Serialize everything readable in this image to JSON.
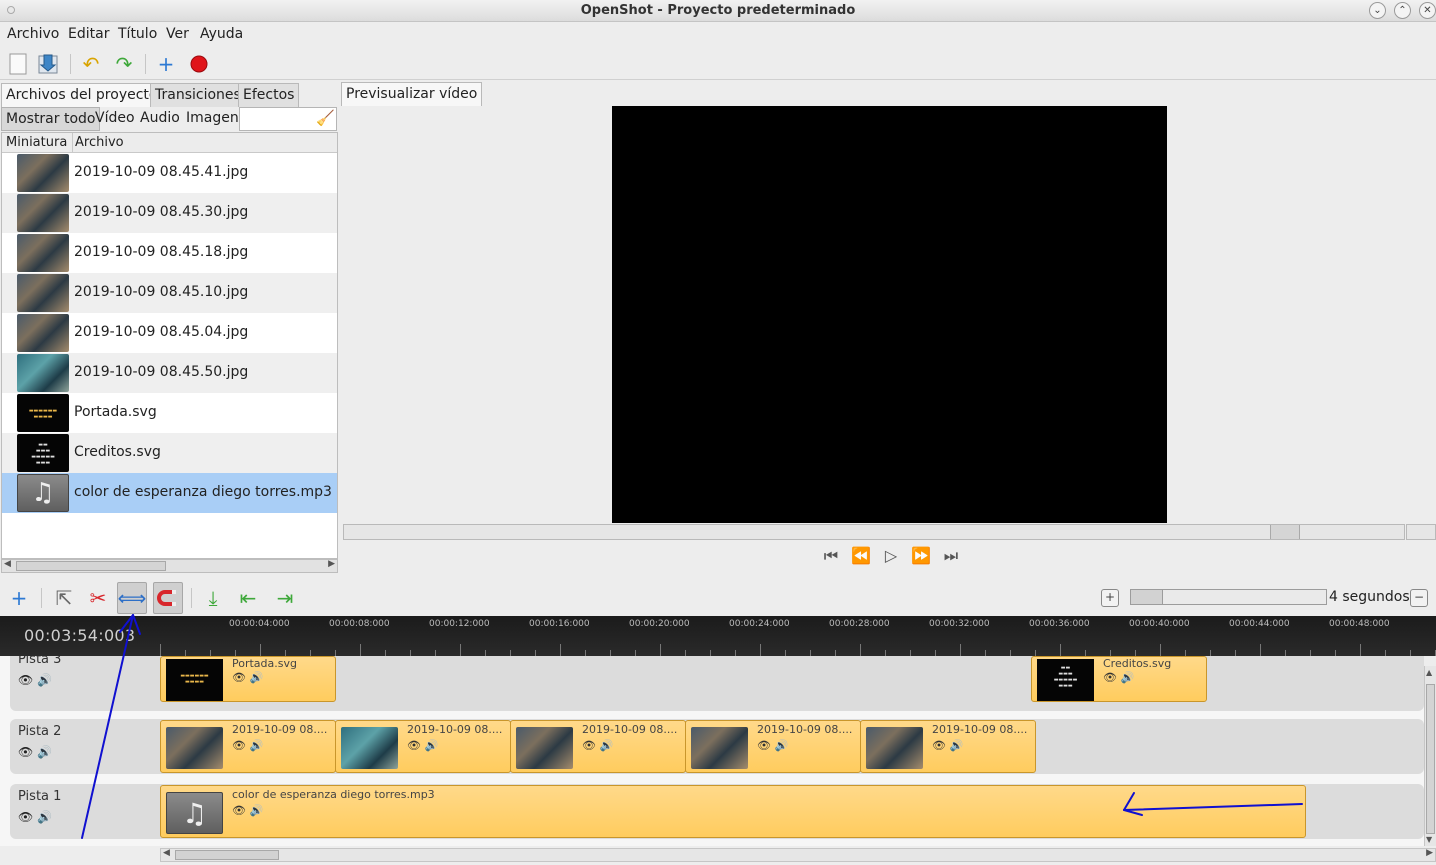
{
  "window": {
    "title": "OpenShot - Proyecto predeterminado"
  },
  "menu": [
    "Archivo",
    "Editar",
    "Título",
    "Ver",
    "Ayuda"
  ],
  "left_tabs": [
    "Archivos del proyecto",
    "Transiciones",
    "Efectos"
  ],
  "filters": [
    "Mostrar todo",
    "Vídeo",
    "Audio",
    "Imagen"
  ],
  "search": {
    "value": ""
  },
  "file_list": {
    "headers": [
      "Miniatura",
      "Archivo"
    ],
    "files": [
      {
        "name": "2019-10-09 08.45.41.jpg",
        "thumb": "photo"
      },
      {
        "name": "2019-10-09 08.45.30.jpg",
        "thumb": "photo"
      },
      {
        "name": "2019-10-09 08.45.18.jpg",
        "thumb": "photo"
      },
      {
        "name": "2019-10-09 08.45.10.jpg",
        "thumb": "photo"
      },
      {
        "name": "2019-10-09 08.45.04.jpg",
        "thumb": "photo"
      },
      {
        "name": "2019-10-09 08.45.50.jpg",
        "thumb": "photo2"
      },
      {
        "name": "Portada.svg",
        "thumb": "dark"
      },
      {
        "name": "Creditos.svg",
        "thumb": "dark"
      },
      {
        "name": "color de esperanza diego torres.mp3",
        "thumb": "music"
      }
    ]
  },
  "preview": {
    "tab": "Previsualizar vídeo"
  },
  "timeline": {
    "zoom_label": "4 segundos",
    "timecode": "00:03:54:003",
    "ruler_labels": [
      "00:00:04:000",
      "00:00:08:000",
      "00:00:12:000",
      "00:00:16:000",
      "00:00:20:000",
      "00:00:24:000",
      "00:00:28:000",
      "00:00:32:000",
      "00:00:36:000",
      "00:00:40:000",
      "00:00:44:000",
      "00:00:48:000"
    ],
    "tracks": [
      {
        "name": "Pista 3"
      },
      {
        "name": "Pista 2"
      },
      {
        "name": "Pista 1"
      }
    ],
    "clips_track3": [
      "Portada.svg",
      "Creditos.svg"
    ],
    "clips_track2": [
      "2019-10-09 08....",
      "2019-10-09 08....",
      "2019-10-09 08....",
      "2019-10-09 08....",
      "2019-10-09 08...."
    ],
    "clips_track1": [
      "color de esperanza diego torres.mp3"
    ]
  },
  "colors": {
    "annotation": "#1010d0",
    "clip": "#ffd27a",
    "selected_row": "#a9cef6"
  }
}
